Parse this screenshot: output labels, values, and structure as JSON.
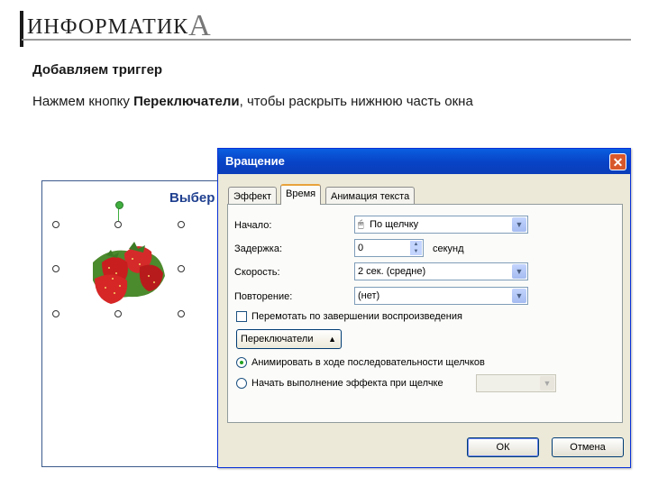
{
  "header": {
    "logo_main": "ИНФОРМАТИК",
    "logo_last": "А"
  },
  "heading": "Добавляем триггер",
  "instruction": {
    "before": "Нажмем кнопку ",
    "bold": "Переключатели",
    "after": ", чтобы раскрыть нижнюю часть окна"
  },
  "slide": {
    "title": "Выбер"
  },
  "dialog": {
    "title": "Вращение",
    "close_icon": "close-icon",
    "tabs": [
      {
        "label": "Эффект",
        "active": false
      },
      {
        "label": "Время",
        "active": true
      },
      {
        "label": "Анимация текста",
        "active": false
      }
    ],
    "start_label": "Начало:",
    "start_value": "По щелчку",
    "delay_label": "Задержка:",
    "delay_value": "0",
    "delay_unit": "секунд",
    "speed_label": "Скорость:",
    "speed_value": "2 сек. (средне)",
    "repeat_label": "Повторение:",
    "repeat_value": "(нет)",
    "rewind_label": "Перемотать по завершении воспроизведения",
    "triggers_button": "Переключатели",
    "radio_animate": "Анимировать в ходе последовательности щелчков",
    "radio_start_on_click": "Начать выполнение эффекта при щелчке",
    "ok": "ОК",
    "cancel": "Отмена"
  }
}
